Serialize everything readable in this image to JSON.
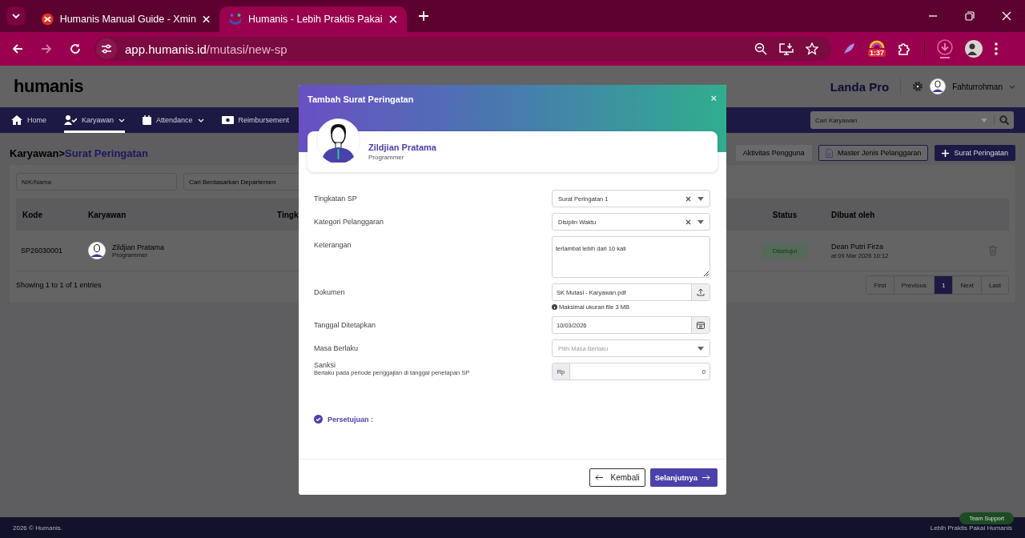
{
  "browser": {
    "tabs": [
      {
        "title": "Humanis Manual Guide - Xmin",
        "selected": false
      },
      {
        "title": "Humanis - Lebih Praktis Pakai",
        "selected": true
      }
    ],
    "url": {
      "host": "app.humanis.id",
      "path": "/mutasi/new-sp"
    },
    "extension_badge": "1:37"
  },
  "app": {
    "logo": "humanis",
    "company": "Landa Pro",
    "user": "Fahturrohman",
    "nav": [
      {
        "label": "Home",
        "dropdown": false,
        "selected": false
      },
      {
        "label": "Karyawan",
        "dropdown": true,
        "selected": true
      },
      {
        "label": "Attendance",
        "dropdown": true,
        "selected": false
      },
      {
        "label": "Reimbursement",
        "dropdown": false,
        "selected": false
      }
    ],
    "search": {
      "placeholder": "Cari Karyawan"
    },
    "breadcrumb": {
      "parent": "Karyawan",
      "separator": ">",
      "current": "Surat Peringatan"
    },
    "actions": [
      {
        "label": "Aktivitas Pengguna",
        "kind": "plain"
      },
      {
        "label": "Master Jenis Pelanggaran",
        "kind": "outline"
      },
      {
        "label": "Surat Peringatan",
        "kind": "primary"
      }
    ],
    "filters": [
      {
        "placeholder": "NIK/Nama"
      },
      {
        "placeholder": "Cari Berdasarkan Departemen"
      }
    ],
    "table": {
      "columns": [
        "Kode",
        "Karyawan",
        "Tingk",
        "Status",
        "Dibuat oleh"
      ],
      "rows": [
        {
          "code": "SP26030001",
          "name": "Zildjian Pratama",
          "role": "Programmer",
          "status": "Disetujui",
          "creator": "Dean Putri Firza",
          "created_at": "at 09 Mar 2026 10:12"
        }
      ]
    },
    "showing": "Showing 1 to 1 of 1 entries",
    "pagination": [
      {
        "label": "First",
        "selected": false
      },
      {
        "label": "Previous",
        "selected": false
      },
      {
        "label": "1",
        "selected": true
      },
      {
        "label": "Next",
        "selected": false
      },
      {
        "label": "Last",
        "selected": false
      }
    ],
    "footer": {
      "left": "2026 © Humanis.",
      "right": "Lebih Praktis Pakai Humanis",
      "support": "Team Support"
    }
  },
  "modal": {
    "title": "Tambah Surat Peringatan",
    "close": "×",
    "employee": {
      "name": "Zildjian Pratama",
      "role": "Programmer"
    },
    "fields": [
      {
        "kind": "select",
        "label": "Tingkatan SP",
        "value": "Surat Peringatan 1",
        "clearable": true
      },
      {
        "kind": "select",
        "label": "Kategori Pelanggaran",
        "value": "Disiplin Waktu",
        "clearable": true
      },
      {
        "kind": "textarea",
        "label": "Keterangan",
        "value": "terlambat lebih dari 10 kali"
      },
      {
        "kind": "file",
        "label": "Dokumen",
        "value": "SK Mutasi - Karyawan.pdf",
        "hint": "Maksimal ukuran file 3 MB"
      },
      {
        "kind": "date",
        "label": "Tanggal Ditetapkan",
        "value": "10/03/2026"
      },
      {
        "kind": "select",
        "label": "Masa Berlaku",
        "placeholder": "Pilih Masa Berlaku",
        "clearable": false
      },
      {
        "kind": "currency",
        "label": "Sanksi",
        "sublabel": "Berlaku pada periode penggajian di tanggal penetapan SP",
        "prefix": "Rp",
        "value": "0"
      }
    ],
    "approval": "Persetujuan :",
    "buttons": {
      "back": "Kembali",
      "next": "Selanjutnya"
    }
  }
}
